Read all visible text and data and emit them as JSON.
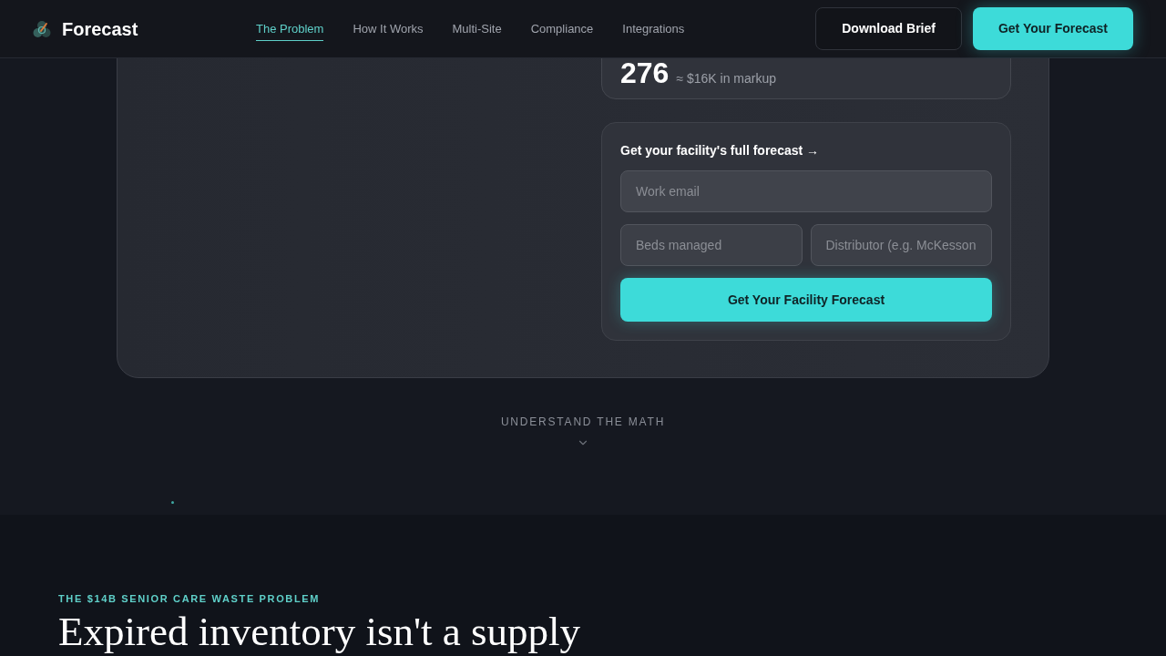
{
  "nav": {
    "brand": "Forecast",
    "links": [
      {
        "label": "The Problem",
        "selected": true
      },
      {
        "label": "How It Works",
        "selected": false
      },
      {
        "label": "Multi-Site",
        "selected": false
      },
      {
        "label": "Compliance",
        "selected": false
      },
      {
        "label": "Integrations",
        "selected": false
      }
    ],
    "buttons": [
      {
        "label": "Download Brief",
        "kind": "secondary"
      },
      {
        "label": "Get Your Forecast",
        "kind": "primary"
      }
    ]
  },
  "hero_card": {
    "stat": {
      "value": "276",
      "caption": "≈ $16K in markup"
    },
    "form": {
      "heading": "Get your facility's full forecast →",
      "fields": [
        {
          "placeholder": "Work email"
        },
        {
          "placeholder": "Beds managed"
        },
        {
          "placeholder": "Distributor (e.g. McKesson"
        }
      ],
      "submit": "Get Your Facility Forecast"
    }
  },
  "scroll_cue": {
    "label": "UNDERSTAND THE MATH"
  },
  "section": {
    "eyebrow": "THE $14B SENIOR CARE WASTE PROBLEM",
    "heading": "Expired inventory isn't a supply"
  }
}
